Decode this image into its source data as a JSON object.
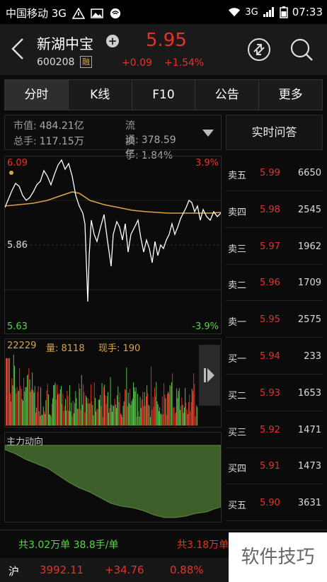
{
  "status_bar": {
    "carrier": "中国移动 3G",
    "network": "3G",
    "time": "07:33"
  },
  "header": {
    "stock_name": "新湖中宝",
    "price": "5.95",
    "code": "600208",
    "margin_badge": "融",
    "change": "+0.09",
    "change_pct": "+1.54%"
  },
  "tabs": [
    "分时",
    "K线",
    "F10",
    "公告",
    "更多"
  ],
  "info": {
    "market_cap_label": "市值:",
    "market_cap": "484.21亿",
    "float_label": "流通:",
    "float": "378.59亿",
    "volume_label": "总手:",
    "volume": "117.15万",
    "turnover_label": "换手:",
    "turnover": "1.84%"
  },
  "realtime_qa": "实时问答",
  "chart": {
    "high": "6.09",
    "mid": "5.86",
    "low": "5.63",
    "high_pct": "3.9%",
    "low_pct": "-3.9%"
  },
  "volume_panel": {
    "label": "22229",
    "vol_label": "量: 8118",
    "current_label": "现手: 190"
  },
  "flow_panel": {
    "title": "主力动向"
  },
  "order_book": [
    {
      "name": "卖五",
      "price": "5.99",
      "qty": "6650"
    },
    {
      "name": "卖四",
      "price": "5.98",
      "qty": "2545"
    },
    {
      "name": "卖三",
      "price": "5.97",
      "qty": "1962"
    },
    {
      "name": "卖二",
      "price": "5.96",
      "qty": "1709"
    },
    {
      "name": "卖一",
      "price": "5.95",
      "qty": "2575"
    },
    {
      "name": "买一",
      "price": "5.94",
      "qty": "233"
    },
    {
      "name": "买二",
      "price": "5.93",
      "qty": "1653"
    },
    {
      "name": "买三",
      "price": "5.92",
      "qty": "1471"
    },
    {
      "name": "买四",
      "price": "5.91",
      "qty": "1473"
    },
    {
      "name": "买五",
      "price": "5.90",
      "qty": "3631"
    }
  ],
  "summary": {
    "left": "共3.02万单 38.8手/单",
    "right": "共3.18万单"
  },
  "index": {
    "name": "沪",
    "value": "3992.11",
    "change": "+34.76",
    "change_pct": "0.88%"
  },
  "watermark": "软件技巧",
  "colors": {
    "up": "#e5332a",
    "down": "#5bd04d",
    "avg_line": "#d9a441",
    "price_line": "#ffffff"
  }
}
